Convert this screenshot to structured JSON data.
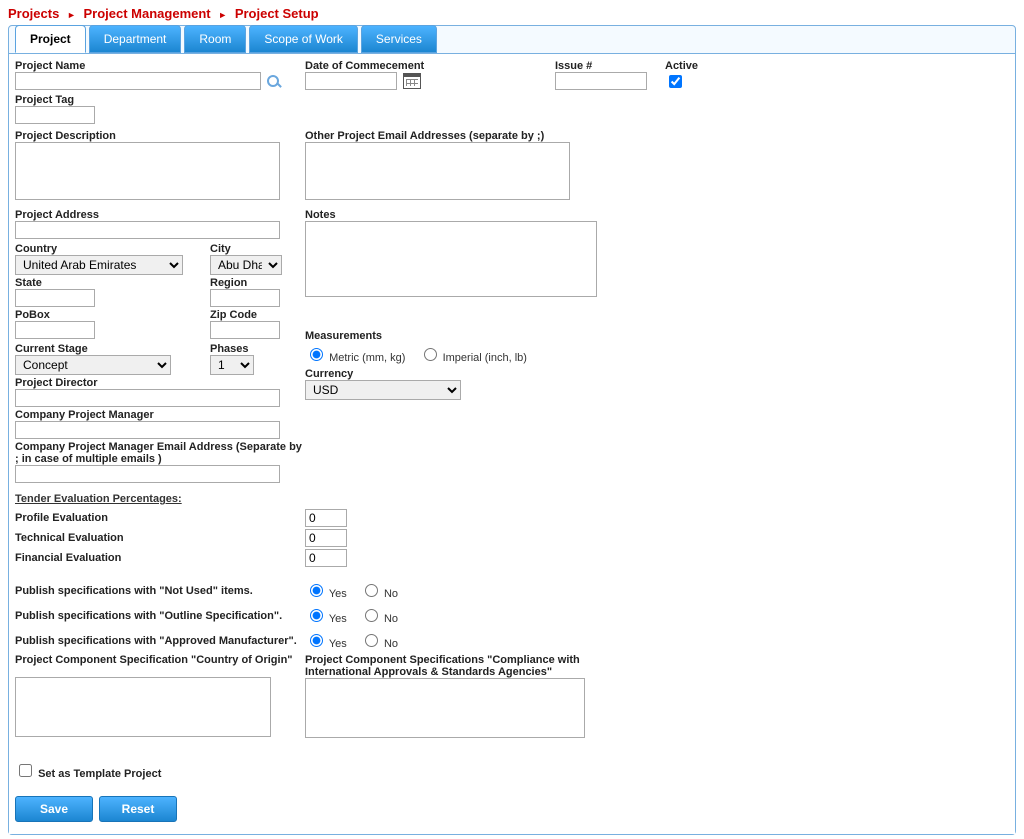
{
  "breadcrumb": [
    "Projects",
    "Project Management",
    "Project Setup"
  ],
  "tabs": [
    "Project",
    "Department",
    "Room",
    "Scope of Work",
    "Services"
  ],
  "labels": {
    "projectName": "Project Name",
    "projectTag": "Project Tag",
    "projectDescription": "Project Description",
    "projectAddress": "Project Address",
    "country": "Country",
    "city": "City",
    "state": "State",
    "region": "Region",
    "pobox": "PoBox",
    "zip": "Zip Code",
    "currentStage": "Current Stage",
    "phases": "Phases",
    "projectDirector": "Project Director",
    "companyPM": "Company Project Manager",
    "companyPMEmail": "Company Project Manager Email Address (Separate by ; in case of multiple emails )",
    "tenderHeader": "Tender Evaluation Percentages:",
    "profileEval": "Profile Evaluation",
    "technicalEval": "Technical Evaluation",
    "financialEval": "Financial Evaluation",
    "dateCommence": "Date of Commecement",
    "otherEmails": "Other Project Email Addresses (separate by ;)",
    "notes": "Notes",
    "measurements": "Measurements",
    "metric": "Metric (mm, kg)",
    "imperial": "Imperial (inch, lb)",
    "currency": "Currency",
    "pubNotUsed": "Publish specifications with \"Not Used\" items.",
    "pubOutline": "Publish specifications with \"Outline Specification\".",
    "pubApproved": "Publish specifications with \"Approved Manufacturer\".",
    "yes": "Yes",
    "no": "No",
    "countryOrigin": "Project Component Specification \"Country of Origin\"",
    "compliance": "Project Component Specifications \"Compliance with International Approvals & Standards Agencies\"",
    "issue": "Issue #",
    "active": "Active",
    "template": "Set as Template Project",
    "save": "Save",
    "reset": "Reset"
  },
  "values": {
    "country": "United Arab Emirates",
    "city": "Abu Dhabi",
    "currentStage": "Concept",
    "phases": "1",
    "currency": "USD",
    "profileEval": "0",
    "technicalEval": "0",
    "financialEval": "0",
    "measurement": "metric",
    "pubNotUsed": "yes",
    "pubOutline": "yes",
    "pubApproved": "yes",
    "active": true,
    "template": false
  }
}
